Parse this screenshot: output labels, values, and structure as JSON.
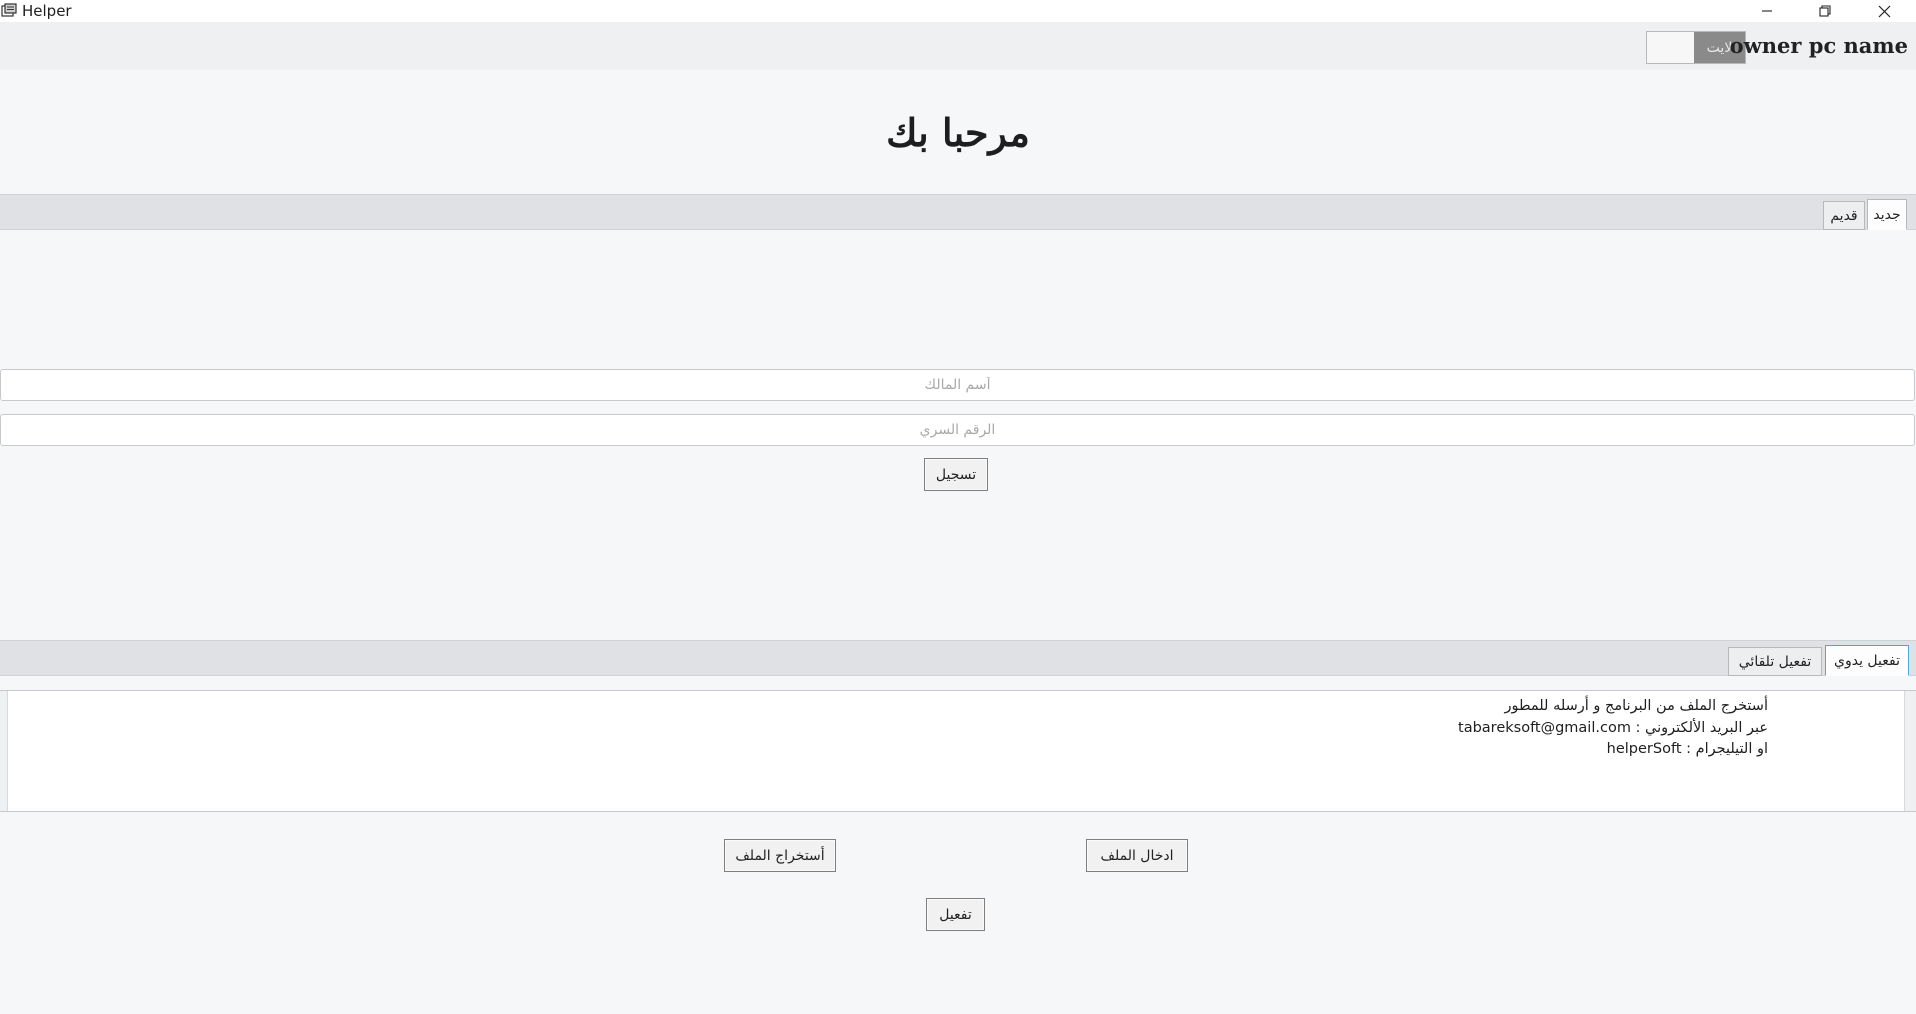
{
  "window": {
    "title": "Helper"
  },
  "header": {
    "owner_name": "owner pc name",
    "theme_toggle_label": "لايت"
  },
  "welcome_title": "مرحبا بك",
  "account_tabs": [
    {
      "label": "جديد",
      "active": true
    },
    {
      "label": "قديم",
      "active": false
    }
  ],
  "form": {
    "owner_placeholder": "أسم المالك",
    "owner_value": "",
    "password_placeholder": "الرقم السري",
    "password_value": "",
    "register_label": "تسجيل"
  },
  "activation_tabs": [
    {
      "label": "تفعيل يدوي",
      "active": true
    },
    {
      "label": "تفعيل تلقائي",
      "active": false
    }
  ],
  "instructions": {
    "line1": "أستخرج الملف من البرنامج و أرسله للمطور",
    "line2": "عبر البريد الألكتروني : tabareksoft@gmail.com",
    "line3": "او التيليجرام : helperSoft"
  },
  "actions": {
    "import_label": "ادخال الملف",
    "export_label": "أستخراج الملف",
    "activate_label": "تفعيل"
  },
  "colors": {
    "accent_tab_border": "#4aa7d8",
    "toggle_thumb": "#8a8a8a"
  }
}
